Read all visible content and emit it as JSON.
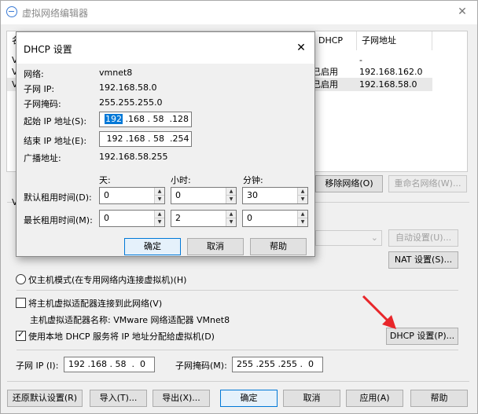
{
  "main_window": {
    "title": "虚拟网络编辑器",
    "close": "✕"
  },
  "net_table": {
    "col_partial": "名",
    "col_dhcp": "DHCP",
    "col_subnet": "子网地址",
    "rows": [
      {
        "name_partial": "V",
        "dhcp": "",
        "subnet": "-"
      },
      {
        "name_partial": "V",
        "dhcp": "已启用",
        "subnet": "192.168.162.0"
      },
      {
        "name_partial": "V",
        "dhcp": "已启用",
        "subnet": "192.168.58.0"
      }
    ]
  },
  "net_buttons": {
    "remove": "移除网络(O)",
    "rename": "重命名网络(W)..."
  },
  "vmnet_info": {
    "group_partial": "V",
    "auto_settings": "自动设置(U)...",
    "nat_settings": "NAT 设置(S)...",
    "host_only_label": "仅主机模式(在专用网络内连接虚拟机)(H)",
    "connect_adapter_label": "将主机虚拟适配器连接到此网络(V)",
    "adapter_name_label": "主机虚拟适配器名称: VMware 网络适配器 VMnet8",
    "use_dhcp_label": "使用本地 DHCP 服务将 IP 地址分配给虚拟机(D)",
    "dhcp_settings": "DHCP 设置(P)...",
    "subnet_ip_label": "子网 IP (I):",
    "subnet_ip_value": "192 .168 . 58  .  0",
    "subnet_mask_label": "子网掩码(M):",
    "subnet_mask_value": "255 .255 .255 .  0"
  },
  "bottom_buttons": {
    "restore": "还原默认设置(R)",
    "import": "导入(T)...",
    "export": "导出(X)...",
    "ok": "确定",
    "cancel": "取消",
    "apply": "应用(A)",
    "help": "帮助"
  },
  "dhcp_dialog": {
    "title": "DHCP 设置",
    "close": "✕",
    "network_label": "网络:",
    "network_value": "vmnet8",
    "subnet_ip_label": "子网 IP:",
    "subnet_ip_value": "192.168.58.0",
    "subnet_mask_label": "子网掩码:",
    "subnet_mask_value": "255.255.255.0",
    "start_ip_label": "起始 IP 地址(S):",
    "start_ip_first": "192",
    "start_ip_rest": " .168 . 58  .128",
    "end_ip_label": "结束 IP 地址(E):",
    "end_ip_value": " 192 .168 . 58  .254",
    "broadcast_label": "广播地址:",
    "broadcast_value": "192.168.58.255",
    "days_label": "天:",
    "hours_label": "小时:",
    "minutes_label": "分钟:",
    "default_lease_label": "默认租用时间(D):",
    "default_days": "0",
    "default_hours": "0",
    "default_minutes": "30",
    "max_lease_label": "最长租用时间(M):",
    "max_days": "0",
    "max_hours": "2",
    "max_minutes": "0",
    "ok": "确定",
    "cancel": "取消",
    "help": "帮助",
    "spin_up": "▲",
    "spin_down": "▼"
  },
  "colors": {
    "selection": "#0078d7",
    "annotation_arrow": "#e8262a"
  }
}
